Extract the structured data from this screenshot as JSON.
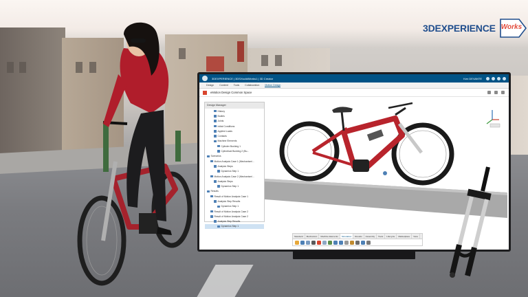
{
  "brand": {
    "name": "3DEXPERIENCE",
    "badge": "Works"
  },
  "app": {
    "title": "3DEXPERIENCE | 3DSXsolidWorks1 | 3D Creator",
    "user": "Ken DEVANTE",
    "menu_tabs": [
      "Design",
      "Content",
      "Tools",
      "Collaboration",
      "Motion Design"
    ],
    "active_menu": "Motion Design",
    "document_title": "eMotion Design   Common Space",
    "tree": {
      "header": "Design Manager",
      "rows": [
        "History",
        "Bodies",
        "Joints",
        "Initial Conditions",
        "Applied Loads",
        "Contacts",
        "Machine Elements",
        "Cylinder Bushing 1",
        "Cylindrical Bushing 2 (Bu...",
        "Scenarios",
        "Motion Analysis Case 1 (Mechanism/...",
        "Analysis Steps",
        "Dynamics Step 1",
        "Motion Analysis Case 2 (Mechanism/...",
        "Analysis Steps",
        "Dynamics Step 1",
        "Results",
        "Result of Motion Analysis Case 1",
        "Analysis Step Results",
        "Dynamics Step 1",
        "Result of Motion Analysis Case 2",
        "Result of Motion Analysis Case 2",
        "Analysis Step Results",
        "Dynamics Step 1"
      ],
      "selected_index": 23
    },
    "action_tabs": [
      "Standard",
      "Mechanism",
      "Machine Elements",
      "Simulation",
      "Results",
      "Assembly",
      "Tools",
      "Lifecycle",
      "Marketplace",
      "View"
    ],
    "active_action_tab": "Simulation",
    "accent": "#005386",
    "status_color": "#d9452e"
  }
}
